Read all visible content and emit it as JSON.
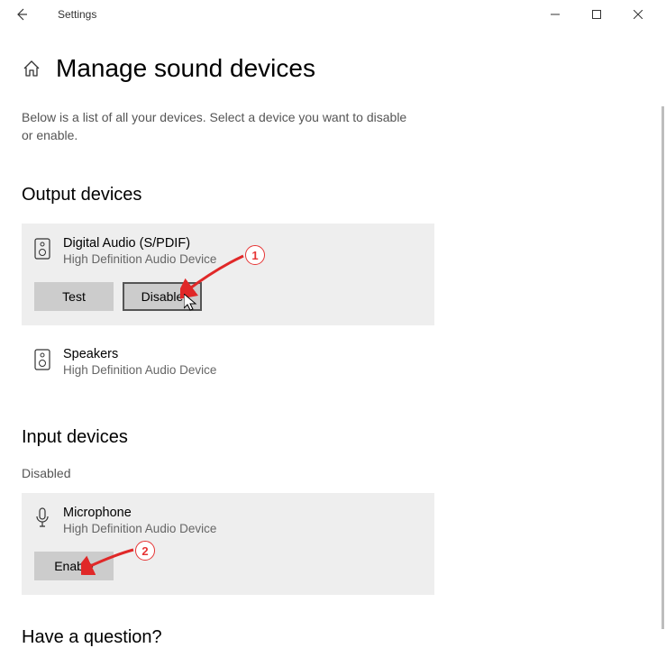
{
  "window": {
    "app_title": "Settings"
  },
  "page": {
    "title": "Manage sound devices",
    "description": "Below is a list of all your devices. Select a device you want to disable or enable."
  },
  "output": {
    "heading": "Output devices",
    "devices": [
      {
        "name": "Digital Audio (S/PDIF)",
        "sub": "High Definition Audio Device"
      },
      {
        "name": "Speakers",
        "sub": "High Definition Audio Device"
      }
    ],
    "test_label": "Test",
    "disable_label": "Disable"
  },
  "input": {
    "heading": "Input devices",
    "disabled_label": "Disabled",
    "devices": [
      {
        "name": "Microphone",
        "sub": "High Definition Audio Device"
      }
    ],
    "enable_label": "Enable"
  },
  "footer": {
    "question_heading": "Have a question?"
  },
  "annotations": {
    "badge1": "1",
    "badge2": "2"
  }
}
